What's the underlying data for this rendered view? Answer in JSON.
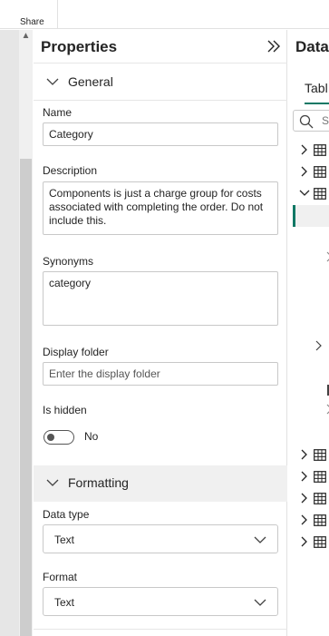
{
  "ribbon": {
    "share_label": "Share"
  },
  "properties": {
    "title": "Properties",
    "sections": {
      "general": "General",
      "formatting": "Formatting"
    },
    "name": {
      "label": "Name",
      "value": "Category"
    },
    "description": {
      "label": "Description",
      "value": "Components is just a charge group for costs associated with completing the order. Do not include this."
    },
    "synonyms": {
      "label": "Synonyms",
      "value": "category"
    },
    "display_folder": {
      "label": "Display folder",
      "placeholder": "Enter the display folder"
    },
    "is_hidden": {
      "label": "Is hidden",
      "state_text": "No",
      "checked": false
    },
    "data_type": {
      "label": "Data type",
      "value": "Text"
    },
    "format": {
      "label": "Format",
      "value": "Text"
    }
  },
  "data_pane": {
    "title": "Data",
    "tab_label": "Tabl",
    "search_placeholder": "S",
    "accent": "#117865"
  },
  "icons": {
    "collapse": "double-chevron-right-icon",
    "section_toggle": "chevron-down-icon",
    "table": "table-icon",
    "search": "search-icon"
  }
}
